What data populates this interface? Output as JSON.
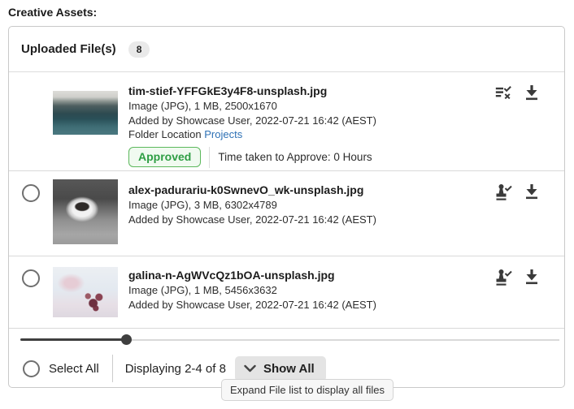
{
  "page": {
    "title": "Creative Assets:"
  },
  "panel": {
    "header": {
      "title": "Uploaded File(s)",
      "count": "8"
    },
    "files": [
      {
        "name": "tim-stief-YFFGkE3y4F8-unsplash.jpg",
        "meta": "Image (JPG), 1 MB, 2500x1670",
        "added": "Added by Showcase User, 2022-07-21 16:42 (AEST)",
        "folder_label": "Folder Location",
        "folder_link": "Projects",
        "status": "Approved",
        "status_note": "Time taken to Approve: 0 Hours",
        "icons": [
          "approval-list-icon",
          "download-icon"
        ]
      },
      {
        "name": "alex-padurariu-k0SwnevO_wk-unsplash.jpg",
        "meta": "Image (JPG), 3 MB, 6302x4789",
        "added": "Added by Showcase User, 2022-07-21 16:42 (AEST)",
        "icons": [
          "approve-stamp-icon",
          "download-icon"
        ]
      },
      {
        "name": "galina-n-AgWVcQz1bOA-unsplash.jpg",
        "meta": "Image (JPG), 1 MB, 5456x3632",
        "added": "Added by Showcase User, 2022-07-21 16:42 (AEST)",
        "icons": [
          "approve-stamp-icon",
          "download-icon"
        ]
      }
    ],
    "slider": {
      "value_percent": 21
    },
    "footer": {
      "select_all_label": "Select All",
      "displaying_text": "Displaying 2-4 of 8",
      "show_all_label": "Show All"
    }
  },
  "tooltip": {
    "text": "Expand File list to display all files"
  },
  "colors": {
    "approved_text": "#2e9e44",
    "approved_border": "#5cb85c",
    "approved_bg": "#f0faf0",
    "link_blue": "#2e71b5",
    "icon_gray": "#3a3a3a",
    "badge_bg": "#e9e9e9",
    "button_bg": "#e4e4e4"
  }
}
